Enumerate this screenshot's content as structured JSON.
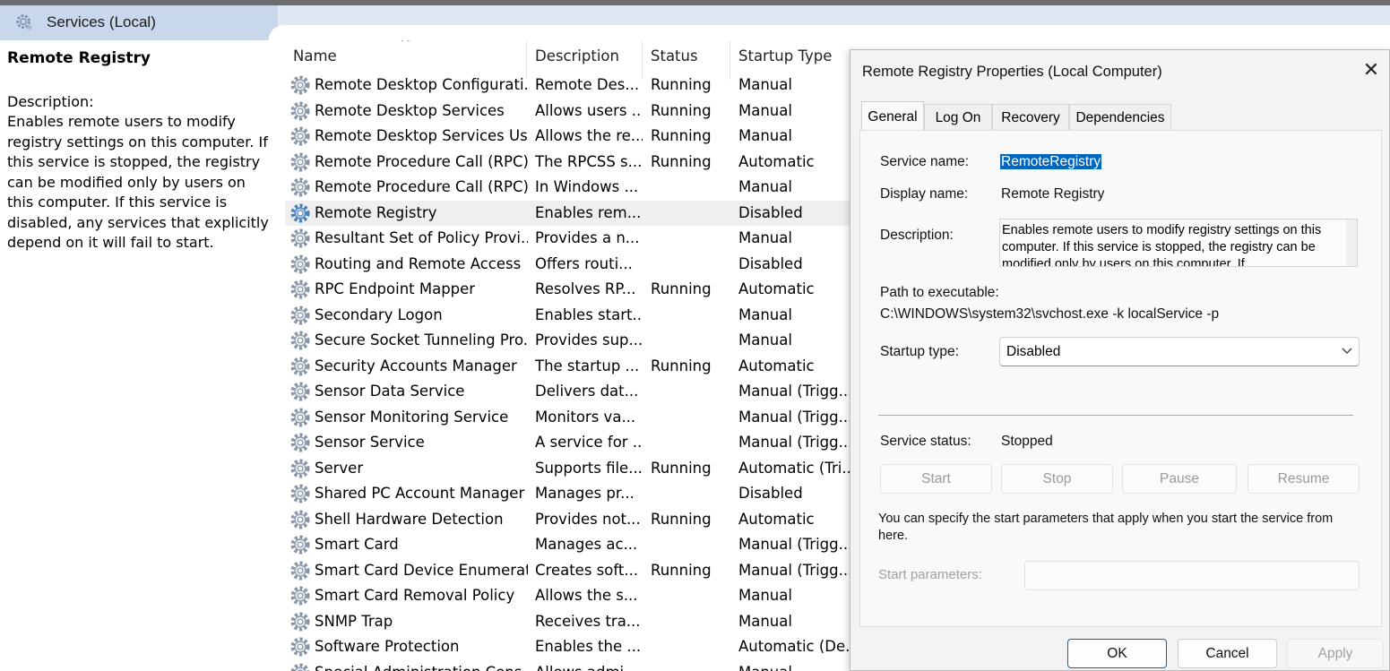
{
  "header": {
    "title": "Services (Local)"
  },
  "left_pane": {
    "service_title": "Remote Registry",
    "description_label": "Description:",
    "description_text": "Enables remote users to modify registry settings on this computer. If this service is stopped, the registry can be modified only by users on this computer. If this service is disabled, any services that explicitly depend on it will fail to start."
  },
  "list": {
    "columns": {
      "name": "Name",
      "description": "Description",
      "status": "Status",
      "startup_type": "Startup Type"
    },
    "rows": [
      {
        "name": "Remote Desktop Configurati...",
        "description": "Remote Des...",
        "status": "Running",
        "startup_type": "Manual"
      },
      {
        "name": "Remote Desktop Services",
        "description": "Allows users ...",
        "status": "Running",
        "startup_type": "Manual"
      },
      {
        "name": "Remote Desktop Services Us...",
        "description": "Allows the re...",
        "status": "Running",
        "startup_type": "Manual"
      },
      {
        "name": "Remote Procedure Call (RPC)",
        "description": "The RPCSS s...",
        "status": "Running",
        "startup_type": "Automatic"
      },
      {
        "name": "Remote Procedure Call (RPC)...",
        "description": "In Windows ...",
        "status": "",
        "startup_type": "Manual"
      },
      {
        "name": "Remote Registry",
        "description": "Enables rem...",
        "status": "",
        "startup_type": "Disabled",
        "selected": true
      },
      {
        "name": "Resultant Set of Policy Provi...",
        "description": "Provides a n...",
        "status": "",
        "startup_type": "Manual"
      },
      {
        "name": "Routing and Remote Access",
        "description": "Offers routi...",
        "status": "",
        "startup_type": "Disabled"
      },
      {
        "name": "RPC Endpoint Mapper",
        "description": "Resolves RP...",
        "status": "Running",
        "startup_type": "Automatic"
      },
      {
        "name": "Secondary Logon",
        "description": "Enables start...",
        "status": "",
        "startup_type": "Manual"
      },
      {
        "name": "Secure Socket Tunneling Pro...",
        "description": "Provides sup...",
        "status": "",
        "startup_type": "Manual"
      },
      {
        "name": "Security Accounts Manager",
        "description": "The startup ...",
        "status": "Running",
        "startup_type": "Automatic"
      },
      {
        "name": "Sensor Data Service",
        "description": "Delivers dat...",
        "status": "",
        "startup_type": "Manual (Trigg..."
      },
      {
        "name": "Sensor Monitoring Service",
        "description": "Monitors va...",
        "status": "",
        "startup_type": "Manual (Trigg..."
      },
      {
        "name": "Sensor Service",
        "description": "A service for ...",
        "status": "",
        "startup_type": "Manual (Trigg..."
      },
      {
        "name": "Server",
        "description": "Supports file...",
        "status": "Running",
        "startup_type": "Automatic (Tri..."
      },
      {
        "name": "Shared PC Account Manager",
        "description": "Manages pr...",
        "status": "",
        "startup_type": "Disabled"
      },
      {
        "name": "Shell Hardware Detection",
        "description": "Provides not...",
        "status": "Running",
        "startup_type": "Automatic"
      },
      {
        "name": "Smart Card",
        "description": "Manages ac...",
        "status": "",
        "startup_type": "Manual (Trigg..."
      },
      {
        "name": "Smart Card Device Enumerat...",
        "description": "Creates soft...",
        "status": "Running",
        "startup_type": "Manual (Trigg..."
      },
      {
        "name": "Smart Card Removal Policy",
        "description": "Allows the s...",
        "status": "",
        "startup_type": "Manual"
      },
      {
        "name": "SNMP Trap",
        "description": "Receives tra...",
        "status": "",
        "startup_type": "Manual"
      },
      {
        "name": "Software Protection",
        "description": "Enables the ...",
        "status": "",
        "startup_type": "Automatic (De..."
      },
      {
        "name": "Special Administration Cons...",
        "description": "Allows admi...",
        "status": "",
        "startup_type": "Manual"
      }
    ]
  },
  "dialog": {
    "title": "Remote Registry Properties (Local Computer)",
    "close_glyph": "✕",
    "tabs": [
      "General",
      "Log On",
      "Recovery",
      "Dependencies"
    ],
    "service_name_label": "Service name:",
    "service_name_value": "RemoteRegistry",
    "display_name_label": "Display name:",
    "display_name_value": "Remote Registry",
    "description_label": "Description:",
    "description_value": "Enables remote users to modify registry settings on this computer. If this service is stopped, the registry can be modified only by users on this computer. If",
    "path_label": "Path to executable:",
    "path_value": "C:\\WINDOWS\\system32\\svchost.exe -k localService -p",
    "startup_type_label": "Startup type:",
    "startup_type_value": "Disabled",
    "service_status_label": "Service status:",
    "service_status_value": "Stopped",
    "buttons": {
      "start": "Start",
      "stop": "Stop",
      "pause": "Pause",
      "resume": "Resume"
    },
    "note": "You can specify the start parameters that apply when you start the service from here.",
    "start_params_label": "Start parameters:",
    "footer": {
      "ok": "OK",
      "cancel": "Cancel",
      "apply": "Apply"
    }
  }
}
